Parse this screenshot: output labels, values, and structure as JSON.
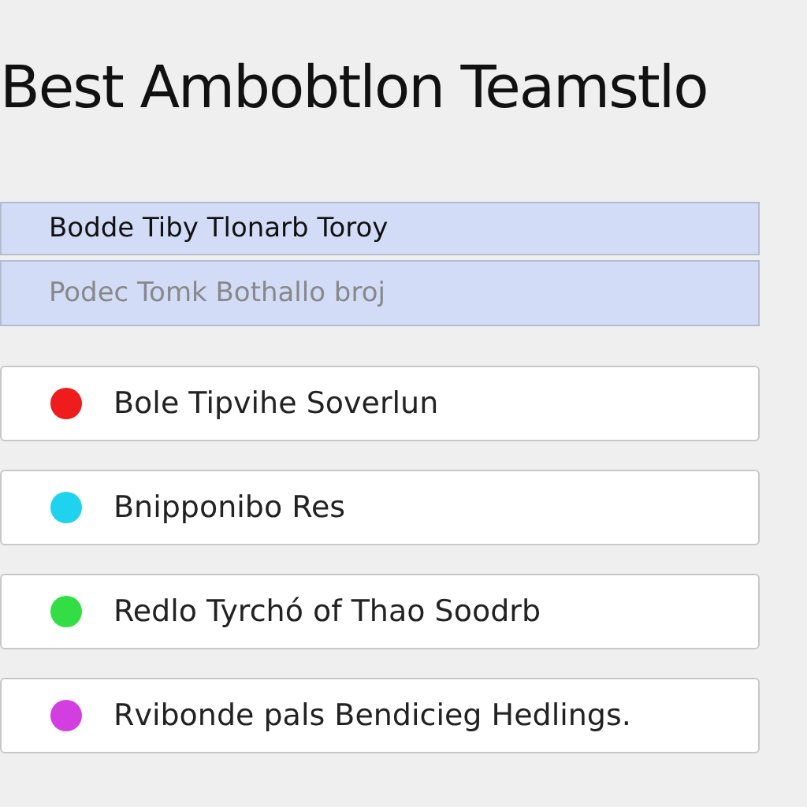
{
  "title": "Best Ambobtlon Teamstlo",
  "options": [
    {
      "label": "Bodde Tiby Tlonarb Toroy",
      "disabled": false
    },
    {
      "label": "Podec Tomk Bothallo broj",
      "disabled": true
    }
  ],
  "items": [
    {
      "label": "Bole Tipvihe Soverlun",
      "color": "#ee1c1c"
    },
    {
      "label": "Bnipponibo Res",
      "color": "#1fd3ef"
    },
    {
      "label": "Redlo Tyrchó of Thao Soodrb",
      "color": "#33dd44"
    },
    {
      "label": "Rvibonde pals Bendicieg Hedlings.",
      "color": "#d23ee0"
    }
  ]
}
